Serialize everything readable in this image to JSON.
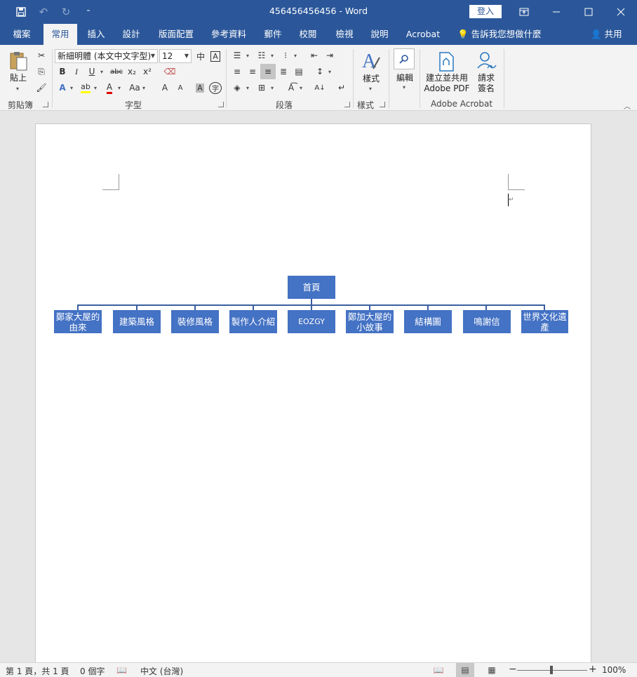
{
  "titlebar": {
    "doc_title": "456456456456  -  Word",
    "signin": "登入",
    "save_icon": "save-icon",
    "undo_icon": "undo-icon",
    "redo_icon": "redo-icon"
  },
  "tabs": [
    "檔案",
    "常用",
    "插入",
    "設計",
    "版面配置",
    "參考資料",
    "郵件",
    "校閱",
    "檢視",
    "說明",
    "Acrobat"
  ],
  "tellme": "告訴我您想做什麼",
  "share": "共用",
  "ribbon": {
    "clipboard": {
      "paste": "貼上",
      "label": "剪貼簿"
    },
    "font": {
      "name": "新細明體 (本文中文字型)",
      "size": "12",
      "label": "字型",
      "bold": "B",
      "italic": "I",
      "underline": "U",
      "strike": "abc",
      "subscript": "x₂",
      "superscript": "x²",
      "grow": "A",
      "shrink": "A",
      "case": "Aa"
    },
    "paragraph": {
      "label": "段落"
    },
    "styles": {
      "label": "樣式",
      "button": "樣式"
    },
    "editing": {
      "button": "編輯"
    },
    "acrobat": {
      "create_line1": "建立並共用",
      "create_line2": "Adobe PDF",
      "sign_line1": "請求",
      "sign_line2": "簽名",
      "label": "Adobe Acrobat"
    }
  },
  "orgchart": {
    "root": "首頁",
    "children": [
      "鄭家大屋的由來",
      "建築風格",
      "裝修風格",
      "製作人介紹",
      "EOZGY",
      "鄭加大屋的小故事",
      "結構圖",
      "鳴謝信",
      "世界文化遺產"
    ]
  },
  "status": {
    "page": "第 1 頁，共 1 頁",
    "words": "0 個字",
    "language": "中文 (台灣)",
    "zoom": "100%"
  }
}
